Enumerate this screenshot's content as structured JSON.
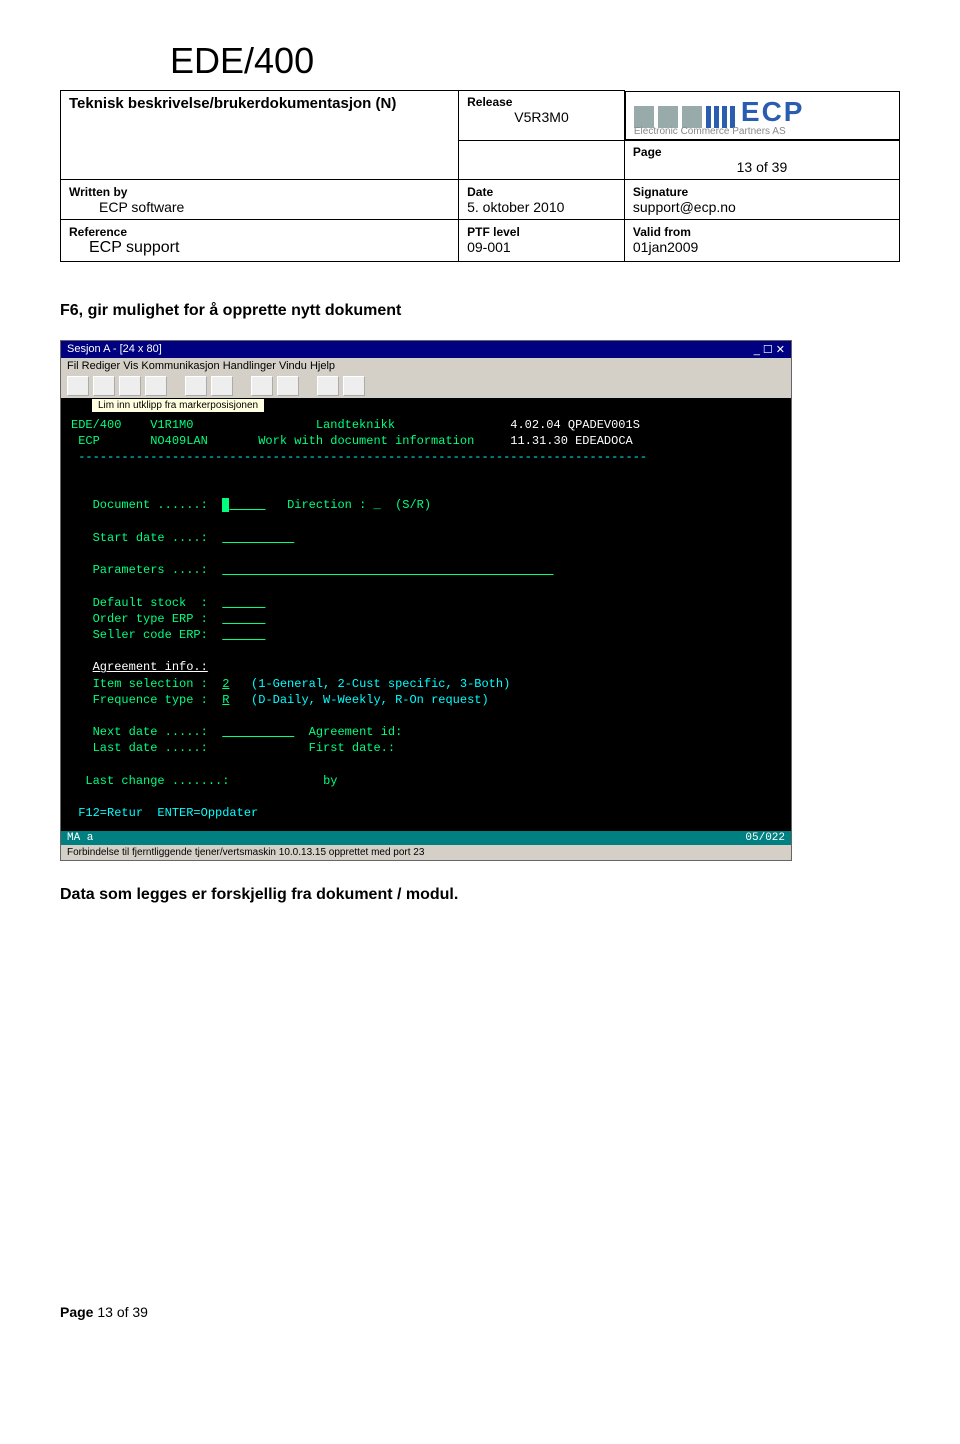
{
  "header": {
    "product": "EDE/400",
    "subtitle": "Teknisk beskrivelse/brukerdokumentasjon (N)",
    "release_label": "Release",
    "release": "V5R3M0",
    "page_label": "Page",
    "page": "13 of 39",
    "written_by_label": "Written by",
    "written_by": "ECP software",
    "date_label": "Date",
    "date": "5. oktober 2010",
    "signature_label": "Signature",
    "signature": "support@ecp.no",
    "reference_label": "Reference",
    "reference": "ECP support",
    "ptf_label": "PTF level",
    "ptf": "09-001",
    "valid_label": "Valid from",
    "valid": "01jan2009",
    "logo_text": "ECP",
    "logo_sub": "Electronic Commerce Partners AS"
  },
  "heading": "F6, gir mulighet for  å opprette nytt dokument",
  "terminal": {
    "title": "Sesjon A - [24 x 80]",
    "menu": "Fil  Rediger  Vis  Kommunikasjon  Handlinger  Vindu  Hjelp",
    "tooltip": "Lim inn utklipp fra markerposisjonen",
    "line1_left": "EDE/400    V1R1M0                 Landteknikk",
    "line1_right": "4.02.04 QPADEV001S",
    "line2_left": "ECP       NO409LAN       Work with document information",
    "line2_right": "11.31.30 EDEADOCA",
    "divider": "-------------------------------------------------------------------------------",
    "doc_label": "Document ......:",
    "dir_label": "Direction : _  (S/R)",
    "start_label": "Start date ....:",
    "param_label": "Parameters ....:",
    "defstock": "Default stock  :",
    "ordertype": "Order type ERP :",
    "seller": "Seller code ERP:",
    "agree_hdr": "Agreement info.:",
    "item_sel": "Item selection :",
    "item_sel_val": "2",
    "item_sel_desc": "(1-General, 2-Cust specific, 3-Both)",
    "freq": "Frequence type :",
    "freq_val": "R",
    "freq_desc": "(D-Daily, W-Weekly, R-On request)",
    "next_date": "Next date .....:",
    "agree_id": "Agreement id:",
    "last_date": "Last date .....:",
    "first_date": "First date.:",
    "last_change": "Last change .......:",
    "by": "by",
    "fkeys": "F12=Retur  ENTER=Oppdater",
    "status_left": "MA    a",
    "status_right": "05/022",
    "status2": "Forbindelse til fjerntliggende tjener/vertsmaskin 10.0.13.15 opprettet med port 23"
  },
  "body_text": "Data som legges er forskjellig fra dokument / modul.",
  "footer": {
    "label": "Page",
    "value": "13 of 39"
  }
}
